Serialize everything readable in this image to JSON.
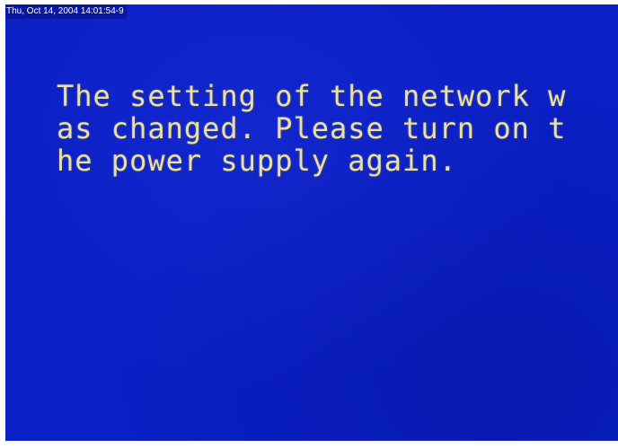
{
  "overlay": {
    "timestamp": "Thu, Oct 14, 2004 14:01:54-9"
  },
  "screen": {
    "background_color": "#0a1fc4",
    "text_color": "#e8e0a8",
    "message_lines": [
      "The setting of the network w",
      "as changed. Please turn on t",
      "he power supply again."
    ]
  }
}
